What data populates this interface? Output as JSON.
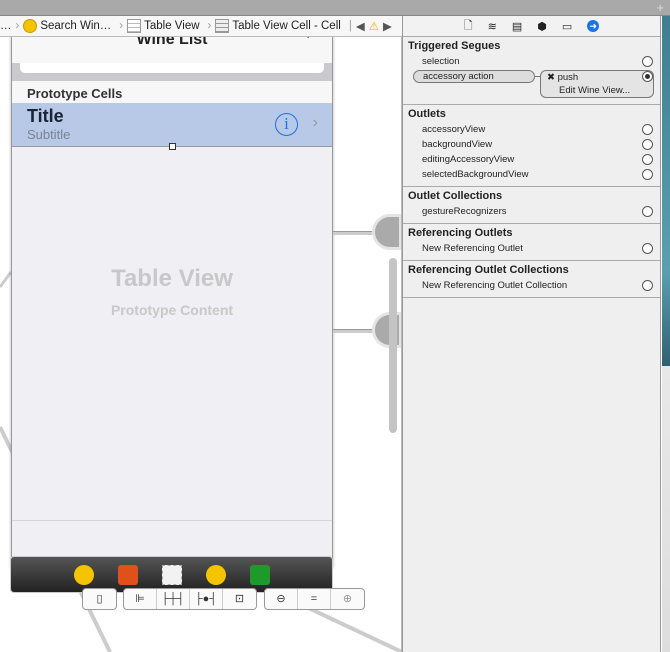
{
  "breadcrumb": {
    "items": [
      {
        "label": "…"
      },
      {
        "label": "Search Win…",
        "icon": "view-controller-icon"
      },
      {
        "label": "Table View",
        "icon": "table-view-icon"
      },
      {
        "label": "Table View Cell - Cell",
        "icon": "table-cell-icon"
      }
    ]
  },
  "phone": {
    "nav_title": "Wine List",
    "add_label": "+",
    "section_header": "Prototype Cells",
    "cell_title": "Title",
    "cell_subtitle": "Subtitle",
    "placeholder_title": "Table View",
    "placeholder_subtitle": "Prototype Content"
  },
  "dock_icons": [
    "view-controller-icon",
    "first-responder-icon",
    "view-icon",
    "exit-icon"
  ],
  "panel": {
    "triggered_segues": {
      "title": "Triggered Segues",
      "selection": "selection",
      "accessory_action": "accessory action",
      "segue_type": "push",
      "segue_target": "Edit Wine View..."
    },
    "outlets": {
      "title": "Outlets",
      "items": [
        "accessoryView",
        "backgroundView",
        "editingAccessoryView",
        "selectedBackgroundView"
      ]
    },
    "outlet_collections": {
      "title": "Outlet Collections",
      "items": [
        "gestureRecognizers"
      ]
    },
    "referencing_outlets": {
      "title": "Referencing Outlets",
      "items": [
        "New Referencing Outlet"
      ]
    },
    "referencing_outlet_collections": {
      "title": "Referencing Outlet Collections",
      "items": [
        "New Referencing Outlet Collection"
      ]
    }
  },
  "colors": {
    "accent": "#1a73e8",
    "selection": "#b7c9e6"
  }
}
